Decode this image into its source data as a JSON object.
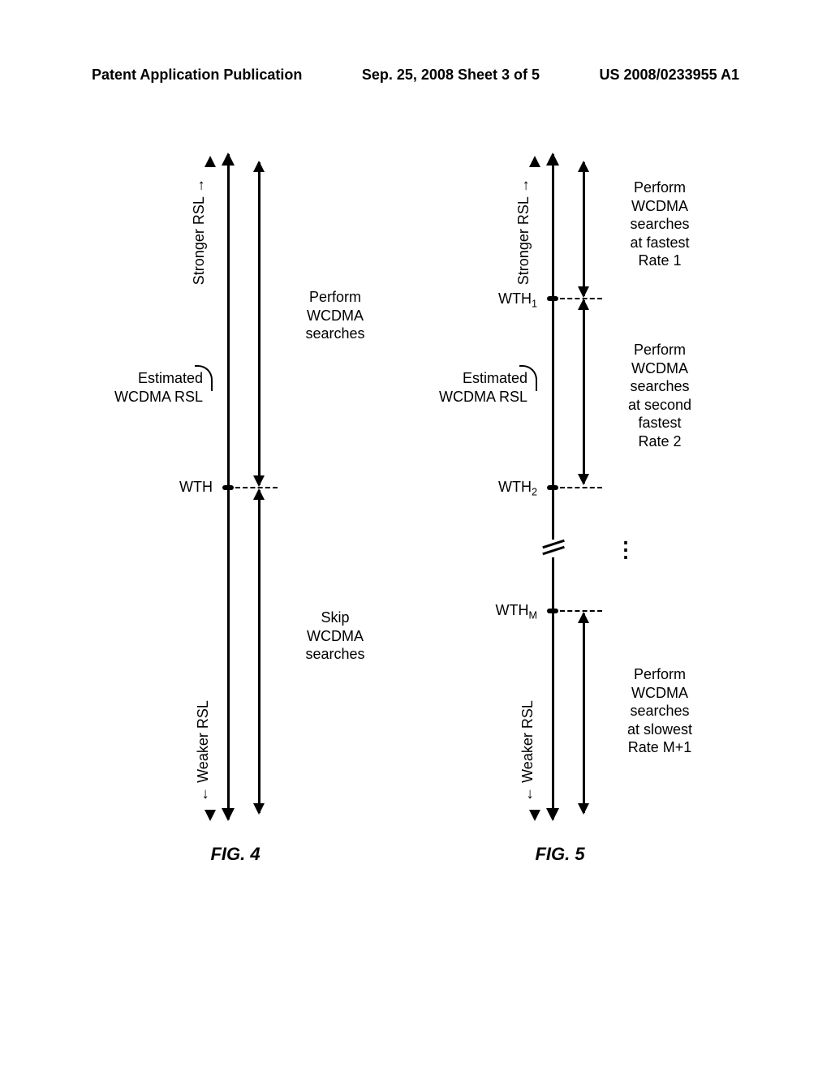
{
  "header": {
    "left": "Patent Application Publication",
    "center": "Sep. 25, 2008  Sheet 3 of 5",
    "right": "US 2008/0233955 A1"
  },
  "common": {
    "stronger": "Stronger RSL",
    "weaker": "Weaker RSL",
    "estimated_line1": "Estimated",
    "estimated_line2": "WCDMA RSL"
  },
  "fig4": {
    "caption": "FIG. 4",
    "threshold": "WTH",
    "range_top": "Perform\nWCDMA\nsearches",
    "range_bottom": "Skip\nWCDMA\nsearches"
  },
  "fig5": {
    "caption": "FIG. 5",
    "threshold1": "WTH₁",
    "threshold2": "WTH₂",
    "thresholdM_prefix": "WTH",
    "thresholdM_sub": "M",
    "range1": "Perform\nWCDMA\nsearches\nat fastest\nRate 1",
    "range2": "Perform\nWCDMA\nsearches\nat second\nfastest\nRate 2",
    "rangeM": "Perform\nWCDMA\nsearches\nat slowest\nRate M+1",
    "dots": "⋮"
  }
}
